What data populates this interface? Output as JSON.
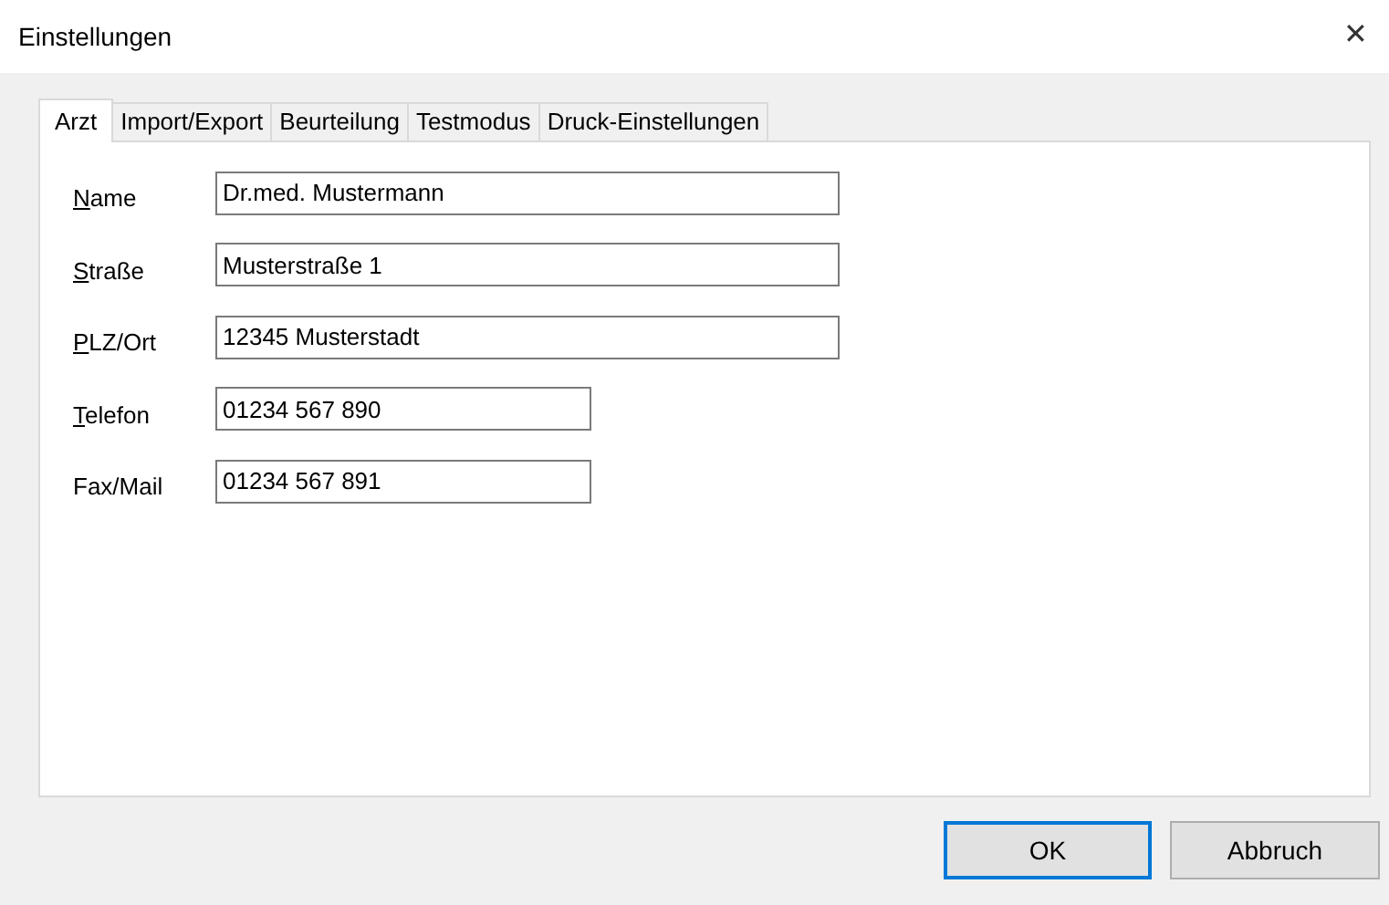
{
  "window": {
    "title": "Einstellungen",
    "close": "✕"
  },
  "tabs": [
    {
      "label": "Arzt",
      "selected": true
    },
    {
      "label": "Import/Export",
      "selected": false
    },
    {
      "label": "Beurteilung",
      "selected": false
    },
    {
      "label": "Testmodus",
      "selected": false
    },
    {
      "label": "Druck-Einstellungen",
      "selected": false
    }
  ],
  "fields": [
    {
      "label": "Name",
      "mnemonic": true,
      "kind": "long",
      "value": "Dr.med. Mustermann"
    },
    {
      "label": "Straße",
      "mnemonic": true,
      "kind": "long",
      "value": "Musterstraße 1"
    },
    {
      "label": "PLZ/Ort",
      "mnemonic": true,
      "kind": "long",
      "value": "12345 Musterstadt"
    },
    {
      "label": "Telefon",
      "mnemonic": true,
      "kind": "short",
      "value": "01234 567 890"
    },
    {
      "label": "Fax/Mail",
      "mnemonic": false,
      "kind": "short",
      "value": "01234 567 891"
    }
  ],
  "buttons": [
    {
      "label": "OK",
      "default": true
    },
    {
      "label": "Abbruch",
      "default": false
    }
  ]
}
